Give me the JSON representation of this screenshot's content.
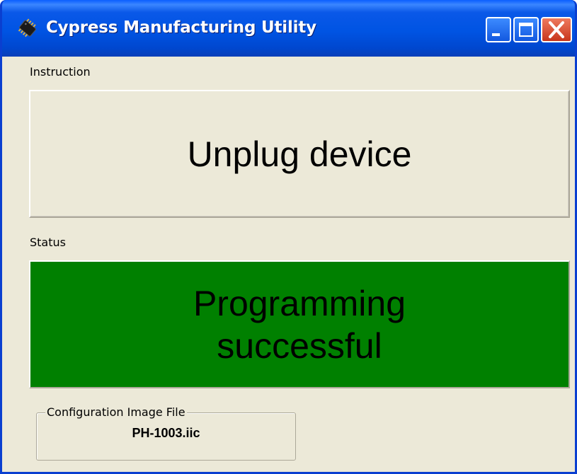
{
  "window": {
    "title": "Cypress Manufacturing Utility",
    "icon": "chip-icon",
    "controls": [
      "minimize-icon",
      "maximize-icon",
      "close-icon"
    ]
  },
  "instruction": {
    "label": "Instruction",
    "text": "Unplug device"
  },
  "status": {
    "label": "Status",
    "text": "Programming successful",
    "color": "#008000"
  },
  "config": {
    "label": "Configuration Image File",
    "file": "PH-1003.iic"
  }
}
